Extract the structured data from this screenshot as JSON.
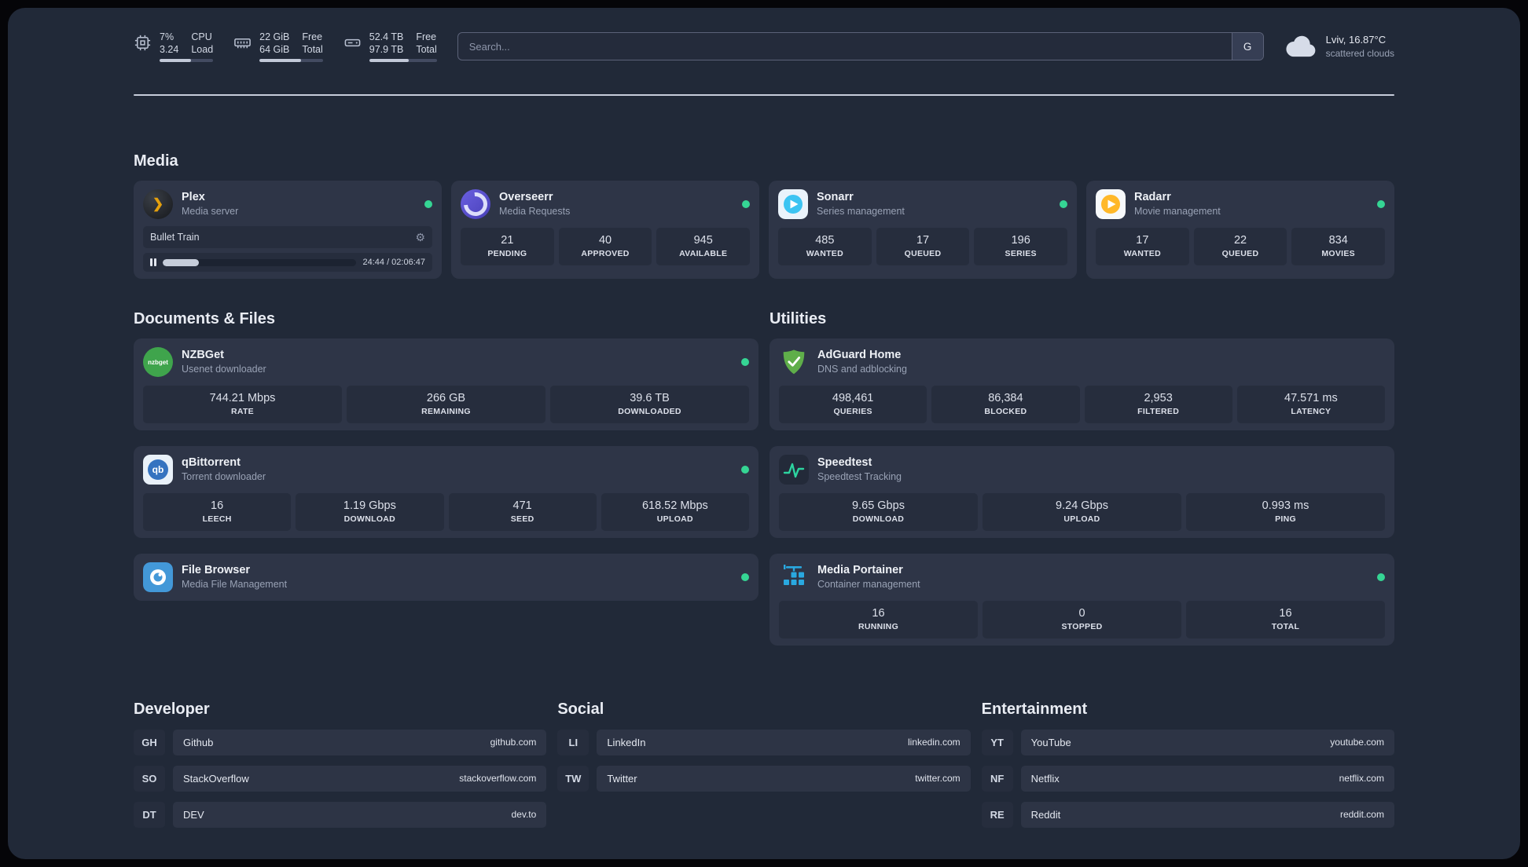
{
  "topbar": {
    "resources": [
      {
        "col1": [
          "7%",
          "3.24"
        ],
        "col2": [
          "CPU",
          "Load"
        ],
        "bar_percent": 58
      },
      {
        "col1": [
          "22 GiB",
          "64 GiB"
        ],
        "col2": [
          "Free",
          "Total"
        ],
        "bar_percent": 66
      },
      {
        "col1": [
          "52.4 TB",
          "97.9 TB"
        ],
        "col2": [
          "Free",
          "Total"
        ],
        "bar_percent": 58
      }
    ],
    "search": {
      "placeholder": "Search...",
      "button_label": "G"
    },
    "weather": {
      "location": "Lviv, 16.87°C",
      "condition": "scattered clouds"
    }
  },
  "media": {
    "heading": "Media",
    "plex": {
      "title": "Plex",
      "subtitle": "Media server",
      "status": "online",
      "now_playing": {
        "track": "Bullet Train",
        "time_display": "24:44 / 02:06:47",
        "progress_percent": 19
      }
    },
    "overseerr": {
      "title": "Overseerr",
      "subtitle": "Media Requests",
      "status": "online",
      "stats": [
        {
          "value": "21",
          "label": "PENDING"
        },
        {
          "value": "40",
          "label": "APPROVED"
        },
        {
          "value": "945",
          "label": "AVAILABLE"
        }
      ]
    },
    "sonarr": {
      "title": "Sonarr",
      "subtitle": "Series management",
      "status": "online",
      "stats": [
        {
          "value": "485",
          "label": "WANTED"
        },
        {
          "value": "17",
          "label": "QUEUED"
        },
        {
          "value": "196",
          "label": "SERIES"
        }
      ]
    },
    "radarr": {
      "title": "Radarr",
      "subtitle": "Movie management",
      "status": "online",
      "stats": [
        {
          "value": "17",
          "label": "WANTED"
        },
        {
          "value": "22",
          "label": "QUEUED"
        },
        {
          "value": "834",
          "label": "MOVIES"
        }
      ]
    }
  },
  "documents": {
    "heading": "Documents & Files",
    "nzbget": {
      "title": "NZBGet",
      "subtitle": "Usenet downloader",
      "status": "online",
      "stats": [
        {
          "value": "744.21 Mbps",
          "label": "RATE"
        },
        {
          "value": "266 GB",
          "label": "REMAINING"
        },
        {
          "value": "39.6 TB",
          "label": "DOWNLOADED"
        }
      ]
    },
    "qbittorrent": {
      "title": "qBittorrent",
      "subtitle": "Torrent downloader",
      "status": "online",
      "stats": [
        {
          "value": "16",
          "label": "LEECH"
        },
        {
          "value": "1.19 Gbps",
          "label": "DOWNLOAD"
        },
        {
          "value": "471",
          "label": "SEED"
        },
        {
          "value": "618.52 Mbps",
          "label": "UPLOAD"
        }
      ]
    },
    "filebrowser": {
      "title": "File Browser",
      "subtitle": "Media File Management",
      "status": "online"
    }
  },
  "utilities": {
    "heading": "Utilities",
    "adguard": {
      "title": "AdGuard Home",
      "subtitle": "DNS and adblocking",
      "stats": [
        {
          "value": "498,461",
          "label": "QUERIES"
        },
        {
          "value": "86,384",
          "label": "BLOCKED"
        },
        {
          "value": "2,953",
          "label": "FILTERED"
        },
        {
          "value": "47.571 ms",
          "label": "LATENCY"
        }
      ]
    },
    "speedtest": {
      "title": "Speedtest",
      "subtitle": "Speedtest Tracking",
      "stats": [
        {
          "value": "9.65 Gbps",
          "label": "DOWNLOAD"
        },
        {
          "value": "9.24 Gbps",
          "label": "UPLOAD"
        },
        {
          "value": "0.993 ms",
          "label": "PING"
        }
      ]
    },
    "portainer": {
      "title": "Media Portainer",
      "subtitle": "Container management",
      "status": "online",
      "stats": [
        {
          "value": "16",
          "label": "RUNNING"
        },
        {
          "value": "0",
          "label": "STOPPED"
        },
        {
          "value": "16",
          "label": "TOTAL"
        }
      ]
    }
  },
  "bookmarks": {
    "developer": {
      "heading": "Developer",
      "items": [
        {
          "abbr": "GH",
          "name": "Github",
          "url": "github.com"
        },
        {
          "abbr": "SO",
          "name": "StackOverflow",
          "url": "stackoverflow.com"
        },
        {
          "abbr": "DT",
          "name": "DEV",
          "url": "dev.to"
        }
      ]
    },
    "social": {
      "heading": "Social",
      "items": [
        {
          "abbr": "LI",
          "name": "LinkedIn",
          "url": "linkedin.com"
        },
        {
          "abbr": "TW",
          "name": "Twitter",
          "url": "twitter.com"
        }
      ]
    },
    "entertainment": {
      "heading": "Entertainment",
      "items": [
        {
          "abbr": "YT",
          "name": "YouTube",
          "url": "youtube.com"
        },
        {
          "abbr": "NF",
          "name": "Netflix",
          "url": "netflix.com"
        },
        {
          "abbr": "RE",
          "name": "Reddit",
          "url": "reddit.com"
        }
      ]
    }
  },
  "colors": {
    "status_online": "#35d594"
  }
}
